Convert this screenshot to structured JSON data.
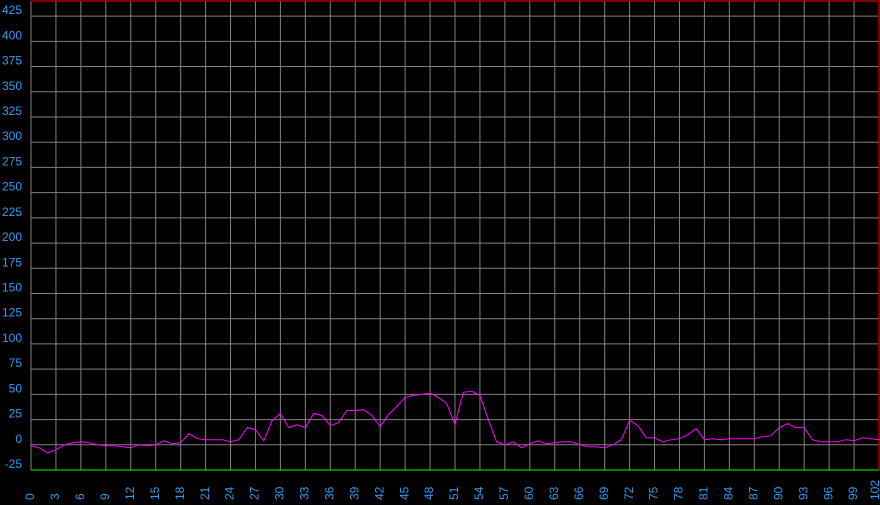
{
  "chart_data": {
    "type": "line",
    "title": "",
    "xlabel": "",
    "ylabel": "",
    "xlim": [
      0,
      102
    ],
    "ylim": [
      -25,
      440
    ],
    "grid": true,
    "y_ticks": [
      -25,
      0,
      25,
      50,
      75,
      100,
      125,
      150,
      175,
      200,
      225,
      250,
      275,
      300,
      325,
      350,
      375,
      400,
      425
    ],
    "x_ticks": [
      0,
      3,
      6,
      9,
      12,
      15,
      18,
      21,
      24,
      27,
      30,
      33,
      36,
      39,
      42,
      45,
      48,
      51,
      54,
      57,
      60,
      63,
      66,
      69,
      72,
      75,
      78,
      81,
      84,
      87,
      90,
      93,
      96,
      99,
      102
    ],
    "series": [
      {
        "values": [
          [
            0,
            -1
          ],
          [
            1,
            -3
          ],
          [
            2,
            -8
          ],
          [
            3,
            -5
          ],
          [
            4,
            0
          ],
          [
            5,
            2
          ],
          [
            6,
            3
          ],
          [
            7,
            2
          ],
          [
            8,
            0
          ],
          [
            9,
            -1
          ],
          [
            10,
            -1
          ],
          [
            11,
            -2
          ],
          [
            12,
            -3
          ],
          [
            13,
            0
          ],
          [
            14,
            -1
          ],
          [
            15,
            0
          ],
          [
            16,
            4
          ],
          [
            17,
            1
          ],
          [
            18,
            2
          ],
          [
            19,
            11
          ],
          [
            20,
            6
          ],
          [
            21,
            5
          ],
          [
            22,
            5
          ],
          [
            23,
            5
          ],
          [
            24,
            3
          ],
          [
            25,
            5
          ],
          [
            26,
            17
          ],
          [
            27,
            15
          ],
          [
            28,
            4
          ],
          [
            29,
            24
          ],
          [
            30,
            31
          ],
          [
            31,
            17
          ],
          [
            32,
            20
          ],
          [
            33,
            17
          ],
          [
            34,
            31
          ],
          [
            35,
            29
          ],
          [
            36,
            19
          ],
          [
            37,
            22
          ],
          [
            38,
            34
          ],
          [
            39,
            34
          ],
          [
            40,
            35
          ],
          [
            41,
            29
          ],
          [
            42,
            18
          ],
          [
            43,
            30
          ],
          [
            44,
            38
          ],
          [
            45,
            47
          ],
          [
            46,
            49
          ],
          [
            47,
            50
          ],
          [
            48,
            51
          ],
          [
            49,
            47
          ],
          [
            50,
            41
          ],
          [
            51,
            20
          ],
          [
            52,
            52
          ],
          [
            53,
            53
          ],
          [
            54,
            49
          ],
          [
            55,
            25
          ],
          [
            56,
            3
          ],
          [
            57,
            0
          ],
          [
            58,
            3
          ],
          [
            59,
            -3
          ],
          [
            60,
            1
          ],
          [
            61,
            4
          ],
          [
            62,
            1
          ],
          [
            63,
            2
          ],
          [
            64,
            3
          ],
          [
            65,
            3
          ],
          [
            66,
            0
          ],
          [
            67,
            -2
          ],
          [
            68,
            -2
          ],
          [
            69,
            -3
          ],
          [
            70,
            0
          ],
          [
            71,
            5
          ],
          [
            72,
            24
          ],
          [
            73,
            19
          ],
          [
            74,
            7
          ],
          [
            75,
            7
          ],
          [
            76,
            3
          ],
          [
            77,
            5
          ],
          [
            78,
            6
          ],
          [
            79,
            10
          ],
          [
            80,
            16
          ],
          [
            81,
            5
          ],
          [
            82,
            6
          ],
          [
            83,
            5
          ],
          [
            84,
            6
          ],
          [
            85,
            6
          ],
          [
            86,
            6
          ],
          [
            87,
            6
          ],
          [
            88,
            8
          ],
          [
            89,
            9
          ],
          [
            90,
            17
          ],
          [
            91,
            21
          ],
          [
            92,
            17
          ],
          [
            93,
            17
          ],
          [
            94,
            5
          ],
          [
            95,
            3
          ],
          [
            96,
            3
          ],
          [
            97,
            3
          ],
          [
            98,
            5
          ],
          [
            99,
            4
          ],
          [
            100,
            7
          ],
          [
            101,
            6
          ],
          [
            102,
            5
          ]
        ],
        "color": "#ff00ff"
      }
    ],
    "colors": {
      "background": "#000000",
      "grid": "#808080",
      "tick_label": "#2a9df4",
      "plot_border": "#ff0000",
      "baseline": "#00ff00",
      "series": "#ff00ff"
    }
  }
}
